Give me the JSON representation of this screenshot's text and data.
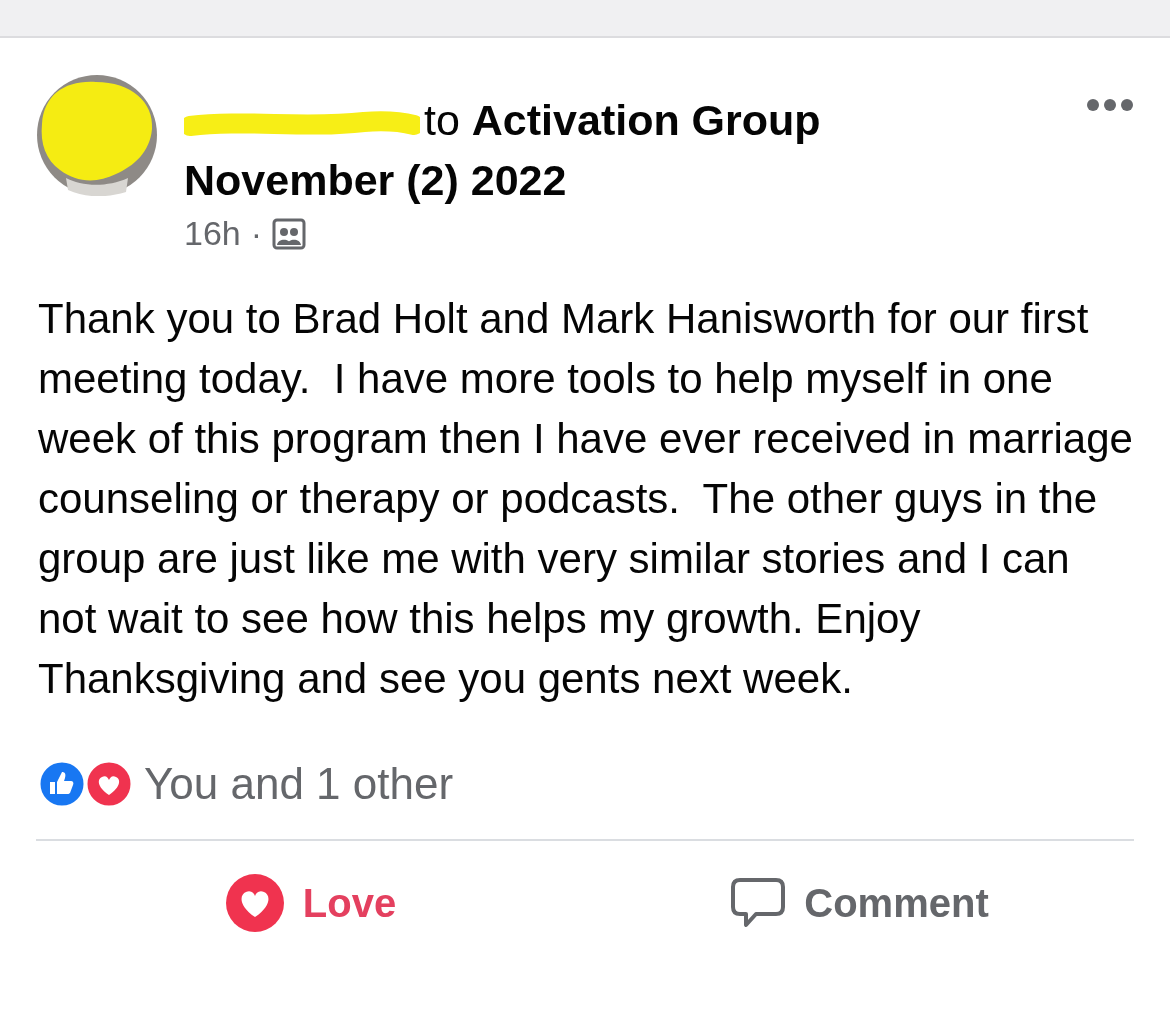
{
  "post": {
    "header": "to **Activation Group November (2) 2022**",
    "time": "16h",
    "separator": "·",
    "body": "Thank you to Brad Holt and Mark Hanisworth for our first meeting today.  I have more tools to help myself in one week of this program then I have ever received in marriage counseling or therapy or podcasts.  The other guys in the group are just like me with very similar stories and I can not wait to see how this helps my growth. Enjoy Thanksgiving and see you gents next week."
  },
  "reactions": {
    "summary": "You and 1 other"
  },
  "actions": [
    {
      "label": "Love",
      "kind": "love",
      "selected": true
    },
    {
      "label": "Comment",
      "kind": "comment",
      "selected": false
    }
  ]
}
